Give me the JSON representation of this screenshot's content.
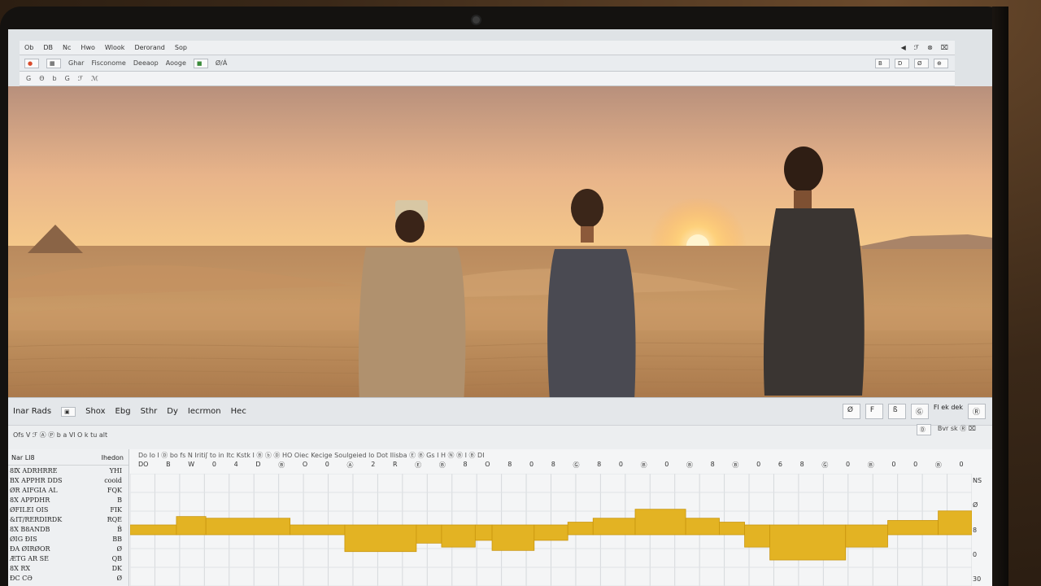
{
  "menubar": {
    "items": [
      "Ob",
      "DB",
      "Nc",
      "Hwo",
      "Wlook",
      "Derorand",
      "Sop"
    ],
    "right": [
      "◀",
      "ℱ",
      "⊗",
      "⌧"
    ]
  },
  "toolbar": {
    "items": [
      "Ghar",
      "Fisconome",
      "Deeaop",
      "Aooge",
      "Ø/Á"
    ],
    "right": [
      "B",
      "D",
      "Ø",
      "⊕"
    ]
  },
  "toolbar2": {
    "items": [
      "G",
      "Θ",
      "b",
      "G",
      "ℱ",
      "ℳ"
    ]
  },
  "panel": {
    "items": [
      "Inar Rads",
      "Shox",
      "Ebg",
      "Sthr",
      "Dy",
      "Iecrmon",
      "Hec"
    ],
    "right": [
      "Ø",
      "F",
      "ß",
      "Ⓖ",
      "Fl ek dek",
      "Ⓡ"
    ]
  },
  "subbar": {
    "row1": [
      "Ofs",
      "V",
      "ℱ",
      "Ⓐ",
      "Ⓟ",
      "b",
      "a",
      "Vl",
      "O",
      "k",
      "tu",
      "alt"
    ],
    "row1_text": "Ofs   V  ℱ Ⓐ  Ⓟ  b  a  Vl  O  k  tu  alt",
    "row2_text": "Bvr sk  Ⓡ  ⌧",
    "pill": "Ⓓ"
  },
  "tracklist": {
    "header_left": "Nar  LI8",
    "header_right": "Ihedon",
    "rows": [
      [
        "8Ⅸ ADRHRRE",
        "YHI"
      ],
      [
        "BX APPHR DDS",
        "cooid"
      ],
      [
        "ØR AIFGIA AL",
        "FQK"
      ],
      [
        "8X APPDHR",
        "B"
      ],
      [
        "ØFILEI OIS",
        "FIK"
      ],
      [
        "&IT/RERDIRDK",
        "RQE"
      ],
      [
        "8X B8ANDB",
        "Ḃ"
      ],
      [
        "ØIG ÐIS",
        "BB"
      ],
      [
        "ÐA ØIRØOR",
        "Ø"
      ],
      [
        "ÆTG AR SE",
        "QB"
      ],
      [
        "8X RX",
        "DK"
      ],
      [
        "ÐC CƏ",
        "Ø"
      ]
    ]
  },
  "ruler": {
    "top_text": "Do  Io   I  Ⓓ  bo  fs  N Iritiʃ  to in  Itc  Kstk  I  Ⓑ  ⓑ  Ⓓ  HO  Oiec  Kecige  Soulgeied  lo   Dot  Ilisba  Ⓔ  Ⓑ  Gs I H Ⓝ  Ⓑ  I Ⓑ  DI",
    "ticks": [
      "DO",
      "B",
      "W",
      "0",
      "4",
      "D",
      "Ⓑ",
      "O",
      "0",
      "Ⓐ",
      "2",
      "R",
      "Ⓔ",
      "Ⓑ",
      "8",
      "O",
      "8",
      "0",
      "8",
      "Ⓖ",
      "8",
      "0",
      "Ⓑ",
      "0",
      "Ⓑ",
      "8",
      "Ⓑ",
      "0",
      "6",
      "8",
      "Ⓖ",
      "0",
      "Ⓑ",
      "0",
      "0",
      "Ⓑ",
      "0"
    ]
  },
  "rightcol": [
    "NS",
    "Ø",
    "8",
    "0",
    "30"
  ],
  "chart_data": {
    "type": "area",
    "title": "",
    "xlabel": "",
    "ylabel": "",
    "ylim": [
      -1,
      1
    ],
    "segments": [
      {
        "start": 0,
        "end": 0.055,
        "value": 0.0
      },
      {
        "start": 0.055,
        "end": 0.09,
        "value": 0.15
      },
      {
        "start": 0.09,
        "end": 0.19,
        "value": 0.12
      },
      {
        "start": 0.19,
        "end": 0.255,
        "value": 0.0
      },
      {
        "start": 0.255,
        "end": 0.34,
        "value": -0.3
      },
      {
        "start": 0.34,
        "end": 0.37,
        "value": -0.15
      },
      {
        "start": 0.37,
        "end": 0.41,
        "value": -0.22
      },
      {
        "start": 0.41,
        "end": 0.43,
        "value": -0.1
      },
      {
        "start": 0.43,
        "end": 0.48,
        "value": -0.28
      },
      {
        "start": 0.48,
        "end": 0.52,
        "value": -0.1
      },
      {
        "start": 0.52,
        "end": 0.55,
        "value": 0.05
      },
      {
        "start": 0.55,
        "end": 0.6,
        "value": 0.12
      },
      {
        "start": 0.6,
        "end": 0.66,
        "value": 0.28
      },
      {
        "start": 0.66,
        "end": 0.7,
        "value": 0.12
      },
      {
        "start": 0.7,
        "end": 0.73,
        "value": 0.05
      },
      {
        "start": 0.73,
        "end": 0.76,
        "value": -0.22
      },
      {
        "start": 0.76,
        "end": 0.85,
        "value": -0.45
      },
      {
        "start": 0.85,
        "end": 0.9,
        "value": -0.22
      },
      {
        "start": 0.9,
        "end": 0.96,
        "value": 0.08
      },
      {
        "start": 0.96,
        "end": 1.0,
        "value": 0.25
      }
    ],
    "fill_color": "#e3b323",
    "stroke_color": "#c9960e"
  },
  "colors": {
    "sky_top": "#c9a28a",
    "sky_glow": "#f5c98a",
    "sand": "#c99a66",
    "accent": "#e3b323"
  }
}
